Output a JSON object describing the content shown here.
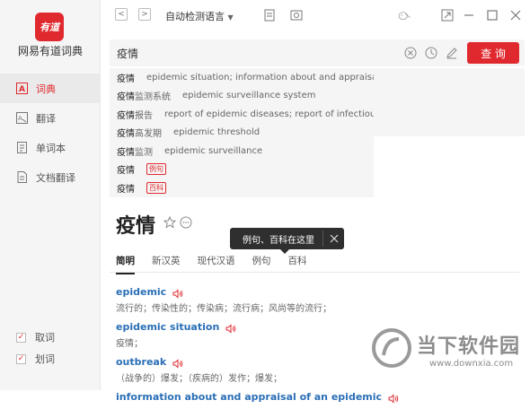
{
  "app": {
    "logo_text": "有道",
    "name": "网易有道词典"
  },
  "sidebar": {
    "items": [
      {
        "label": "词典",
        "active": true
      },
      {
        "label": "翻译",
        "active": false
      },
      {
        "label": "单词本",
        "active": false
      },
      {
        "label": "文档翻译",
        "active": false
      }
    ],
    "checkboxes": [
      {
        "label": "取词",
        "checked": true
      },
      {
        "label": "划词",
        "checked": true
      }
    ]
  },
  "topbar": {
    "back": "<",
    "forward": ">",
    "language": "自动检测语言"
  },
  "search": {
    "value": "疫情",
    "button": "查 询"
  },
  "suggestions": [
    {
      "hl": "疫情",
      "rest": "",
      "def": "epidemic situation; information about and appraisa..."
    },
    {
      "hl": "疫情",
      "rest": "监测系统",
      "def": "epidemic surveillance system"
    },
    {
      "hl": "疫情",
      "rest": "报告",
      "def": "report of epidemic diseases; report of infectious ..."
    },
    {
      "hl": "疫情",
      "rest": "高发期",
      "def": "epidemic threshold"
    },
    {
      "hl": "疫情",
      "rest": "监测",
      "def": "epidemic surveillance"
    },
    {
      "hl": "疫情",
      "rest": "",
      "tag": "例句"
    },
    {
      "hl": "疫情",
      "rest": "",
      "tag": "百科"
    }
  ],
  "main": {
    "word": "疫情",
    "tabs": [
      "简明",
      "新汉英",
      "现代汉语",
      "例句",
      "百科"
    ],
    "tooltip": "例句、百科在这里",
    "entries": [
      {
        "word": "epidemic",
        "def": "流行的；传染性的；传染病；流行病；风尚等的流行；"
      },
      {
        "word": "epidemic situation",
        "def": "疫情；"
      },
      {
        "word": "outbreak",
        "def": "（战争的）爆发；（疾病的）发作；爆发；"
      },
      {
        "word": "information about and appraisal of an epidemic",
        "def": ""
      }
    ]
  },
  "watermark": {
    "text": "当下软件园",
    "url": "www.downxia.com"
  },
  "colors": {
    "brand": "#e0292e",
    "link": "#2a6fb6"
  }
}
